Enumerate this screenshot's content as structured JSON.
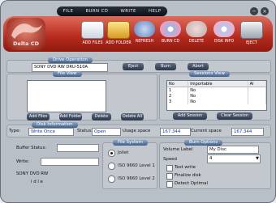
{
  "menu": [
    "FILE",
    "BURN CD",
    "WRITE",
    "HELP"
  ],
  "window_controls": [
    "−",
    "×"
  ],
  "logo_text": "Delta CD",
  "toolbar": [
    {
      "label": "ADD FILES",
      "icon": "add-files-icon"
    },
    {
      "label": "ADD FOLDER",
      "icon": "add-folder-icon"
    },
    {
      "label": "REFRESH",
      "icon": "refresh-icon"
    },
    {
      "label": "BURN CD",
      "icon": "burn-cd-icon"
    },
    {
      "label": "DELETE",
      "icon": "delete-icon"
    },
    {
      "label": "DISK INFO",
      "icon": "disk-info-icon"
    },
    {
      "label": "EJECT",
      "icon": "eject-icon"
    }
  ],
  "drive_operation": {
    "title": "Drive Operation",
    "drive": "SONY   DVD RW DRU-510A",
    "eject": "Eject",
    "burn": "Burn",
    "abort": "Abort"
  },
  "file_view": {
    "title": "File View",
    "buttons": [
      "Add Files",
      "Add Folder",
      "Delete",
      "Delete All"
    ]
  },
  "sessions_view": {
    "title": "Sessions View",
    "columns": [
      "No",
      "Importable",
      "Al"
    ],
    "rows": [
      {
        "no": "1",
        "importable": "No"
      },
      {
        "no": "2",
        "importable": "No"
      },
      {
        "no": "3",
        "importable": "No"
      }
    ],
    "buttons": [
      "Add Session",
      "Clear Session"
    ]
  },
  "disk_information": {
    "title": "Disk Information",
    "type_label": "Type:",
    "type_value": "Write Once",
    "status_label": "Status:",
    "status_value": "Open",
    "usage_label": "Usage space",
    "usage_value": "167.344",
    "current_label": "Current space",
    "current_value": "167.344"
  },
  "buffer": {
    "status_label": "Buffer Status:",
    "write_label": "Write:",
    "device": "SONY    DVD RW",
    "state": "i d l e"
  },
  "file_system": {
    "title": "File System",
    "options": [
      "Joliet",
      "ISO 9660 Level 1",
      "ISO 9660 Level 2"
    ],
    "selected": 0
  },
  "burn_options": {
    "title": "Burn Options",
    "volume_label": "Volume Label",
    "volume_value": "My Disc",
    "speed_label": "Speed",
    "speed_value": "4",
    "checks": [
      "Test write",
      "Finalize disk",
      "Detect Optimal"
    ]
  }
}
